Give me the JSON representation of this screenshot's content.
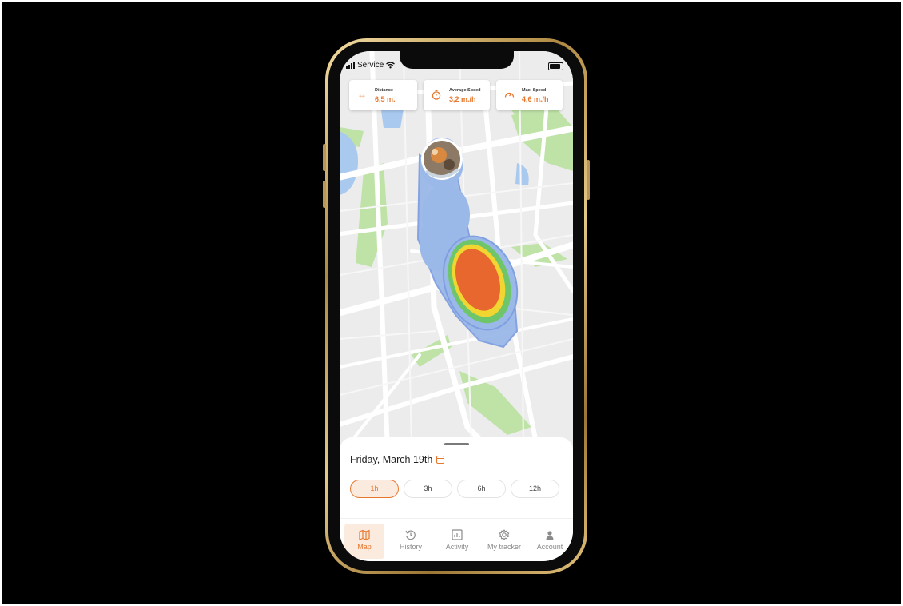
{
  "status_bar": {
    "carrier": "Service"
  },
  "stats": [
    {
      "label": "Distance",
      "value": "6,5 m.",
      "icon": "arrows-horizontal-icon"
    },
    {
      "label": "Average Speed",
      "value": "3,2 m./h",
      "icon": "stopwatch-icon"
    },
    {
      "label": "Max. Speed",
      "value": "4,6 m./h",
      "icon": "speedometer-icon"
    }
  ],
  "sheet": {
    "date": "Friday, March 19th",
    "ranges": [
      "1h",
      "3h",
      "6h",
      "12h"
    ],
    "selected_range": "1h"
  },
  "tabs": [
    {
      "label": "Map",
      "icon": "map-icon",
      "active": true
    },
    {
      "label": "History",
      "icon": "history-icon",
      "active": false
    },
    {
      "label": "Activity",
      "icon": "activity-chart-icon",
      "active": false
    },
    {
      "label": "My tracker",
      "icon": "gear-icon",
      "active": false
    },
    {
      "label": "Account",
      "icon": "person-icon",
      "active": false
    }
  ],
  "colors": {
    "accent": "#e8772e",
    "heat_low": "#9ab8e8",
    "heat_mid": "#6fc66a",
    "heat_warm": "#f1d530",
    "heat_high": "#e8672e",
    "park": "#bfe3a7",
    "water": "#a9c9ef"
  }
}
